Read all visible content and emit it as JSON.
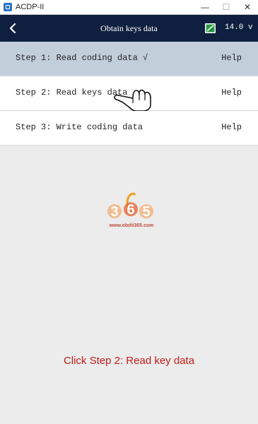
{
  "window": {
    "title": "ACDP-II",
    "minimize": "—",
    "maximize": "☐",
    "close": "✕"
  },
  "header": {
    "title": "Obtain keys data",
    "voltage": "14.0 v",
    "icons": {
      "back": "chevron-left-icon",
      "battery": "battery-icon"
    },
    "colors": {
      "bar": "#0e1f3f",
      "battery": "#2e9a4a"
    }
  },
  "steps": [
    {
      "label": "Step 1: Read coding data √",
      "help": "Help",
      "selected": true
    },
    {
      "label": "Step 2: Read keys data",
      "help": "Help",
      "selected": false
    },
    {
      "label": "Step 3: Write coding data",
      "help": "Help",
      "selected": false
    }
  ],
  "watermark": {
    "logo_text": [
      "3",
      "6",
      "5"
    ],
    "url": "www.obdii365.com"
  },
  "caption": "Click Step 2: Read key data"
}
